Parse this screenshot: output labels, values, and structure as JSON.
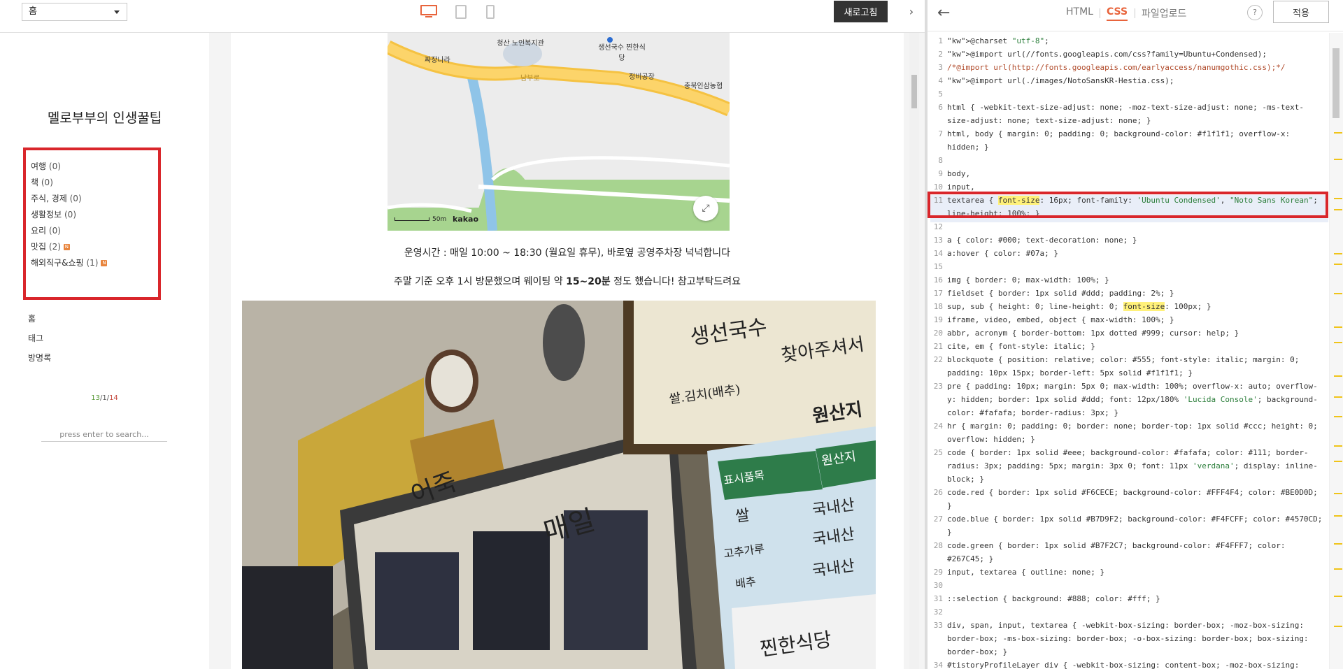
{
  "toolbar": {
    "page_select": "홈",
    "refresh_label": "새로고침",
    "collapse_icon": "›"
  },
  "sidebar": {
    "blog_title": "멜로부부의 인생꿀팁",
    "categories": [
      {
        "label": "여행",
        "count": "(0)",
        "badge": ""
      },
      {
        "label": "책",
        "count": "(0)",
        "badge": ""
      },
      {
        "label": "주식, 경제",
        "count": "(0)",
        "badge": ""
      },
      {
        "label": "생활정보",
        "count": "(0)",
        "badge": ""
      },
      {
        "label": "요리",
        "count": "(0)",
        "badge": ""
      },
      {
        "label": "맛집",
        "count": "(2)",
        "badge": "N"
      },
      {
        "label": "해외직구&쇼핑",
        "count": "(1)",
        "badge": "N"
      }
    ],
    "nav": [
      "홈",
      "태그",
      "방명록"
    ],
    "counter": {
      "today": "13",
      "sep1": "/",
      "yesterday": "1",
      "sep2": "/",
      "total": "14"
    },
    "search_placeholder": "press enter to search..."
  },
  "post": {
    "map": {
      "labels": [
        "짜장나라",
        "청산 노인복지관",
        "생선국수 찐한식당",
        "정비공장",
        "충북인삼농협",
        "남부로"
      ],
      "scale": "50m",
      "brand": "kakao"
    },
    "line1": "운영시간 : 매일 10:00 ~ 18:30 (월요일 휴무), 바로옆 공영주차장 넉넉합니다",
    "line2_prefix": "주말 기준 오후 1시 방문했으며 웨이팅 약 ",
    "line2_bold": "15~20분",
    "line2_suffix": " 정도 했습니다! 참고부탁드려요",
    "photo_texts": [
      "생선국수",
      "찾아주셔서",
      "쌀.김치(배추)",
      "원산지",
      "원산지",
      "표시품목",
      "쌀",
      "국내산",
      "고추가루",
      "국내산",
      "배추",
      "국내산",
      "찐한식당",
      "어죽",
      "매일"
    ]
  },
  "editor": {
    "back_icon": "←",
    "tabs": [
      "HTML",
      "CSS",
      "파일업로드"
    ],
    "help": "?",
    "apply": "적용",
    "code": [
      {
        "n": "1",
        "t": "@charset \"utf-8\";"
      },
      {
        "n": "2",
        "t": "@import url(//fonts.googleapis.com/css?family=Ubuntu+Condensed);"
      },
      {
        "n": "3",
        "t": "/*@import url(http://fonts.googleapis.com/earlyaccess/nanumgothic.css);*/"
      },
      {
        "n": "4",
        "t": "@import url(./images/NotoSansKR-Hestia.css);"
      },
      {
        "n": "5",
        "t": ""
      },
      {
        "n": "6",
        "t": "html { -webkit-text-size-adjust: none; -moz-text-size-adjust: none; -ms-text-"
      },
      {
        "n": "",
        "t": "size-adjust: none; text-size-adjust: none; }"
      },
      {
        "n": "7",
        "t": "html, body { margin: 0; padding: 0; background-color: #f1f1f1; overflow-x:"
      },
      {
        "n": "",
        "t": "hidden; }"
      },
      {
        "n": "8",
        "t": ""
      },
      {
        "n": "9",
        "t": "body,"
      },
      {
        "n": "10",
        "t": "input,"
      },
      {
        "n": "11",
        "t": "textarea { font-size: 16px; font-family: 'Ubuntu Condensed', \"Noto Sans Korean\";"
      },
      {
        "n": "",
        "t": "line-height: 100%; }"
      },
      {
        "n": "12",
        "t": ""
      },
      {
        "n": "13",
        "t": "a { color: #000; text-decoration: none; }"
      },
      {
        "n": "14",
        "t": "a:hover { color: #07a; }"
      },
      {
        "n": "15",
        "t": ""
      },
      {
        "n": "16",
        "t": "img { border: 0; max-width: 100%; }"
      },
      {
        "n": "17",
        "t": "fieldset { border: 1px solid #ddd; padding: 2%; }"
      },
      {
        "n": "18",
        "t": "sup, sub { height: 0; line-height: 0; font-size: 100px; }"
      },
      {
        "n": "19",
        "t": "iframe, video, embed, object { max-width: 100%; }"
      },
      {
        "n": "20",
        "t": "abbr, acronym { border-bottom: 1px dotted #999; cursor: help; }"
      },
      {
        "n": "21",
        "t": "cite, em { font-style: italic; }"
      },
      {
        "n": "22",
        "t": "blockquote { position: relative; color: #555; font-style: italic; margin: 0;"
      },
      {
        "n": "",
        "t": "padding: 10px 15px; border-left: 5px solid #f1f1f1; }"
      },
      {
        "n": "23",
        "t": "pre { padding: 10px; margin: 5px 0; max-width: 100%; overflow-x: auto; overflow-"
      },
      {
        "n": "",
        "t": "y: hidden; border: 1px solid #ddd; font: 12px/180% 'Lucida Console'; background-"
      },
      {
        "n": "",
        "t": "color: #fafafa; border-radius: 3px; }"
      },
      {
        "n": "24",
        "t": "hr { margin: 0; padding: 0; border: none; border-top: 1px solid #ccc; height: 0;"
      },
      {
        "n": "",
        "t": "overflow: hidden; }"
      },
      {
        "n": "25",
        "t": "code { border: 1px solid #eee; background-color: #fafafa; color: #111; border-"
      },
      {
        "n": "",
        "t": "radius: 3px; padding: 5px; margin: 3px 0; font: 11px 'verdana'; display: inline-"
      },
      {
        "n": "",
        "t": "block; }"
      },
      {
        "n": "26",
        "t": "code.red { border: 1px solid #F6CECE; background-color: #FFF4F4; color: #BE0D0D;"
      },
      {
        "n": "",
        "t": "}"
      },
      {
        "n": "27",
        "t": "code.blue { border: 1px solid #B7D9F2; background-color: #F4FCFF; color: #4570CD;"
      },
      {
        "n": "",
        "t": "}"
      },
      {
        "n": "28",
        "t": "code.green { border: 1px solid #B7F2C7; background-color: #F4FFF7; color:"
      },
      {
        "n": "",
        "t": "#267C45; }"
      },
      {
        "n": "29",
        "t": "input, textarea { outline: none; }"
      },
      {
        "n": "30",
        "t": ""
      },
      {
        "n": "31",
        "t": "::selection { background: #888; color: #fff; }"
      },
      {
        "n": "32",
        "t": ""
      },
      {
        "n": "33",
        "t": "div, span, input, textarea { -webkit-box-sizing: border-box; -moz-box-sizing:"
      },
      {
        "n": "",
        "t": "border-box; -ms-box-sizing: border-box; -o-box-sizing: border-box; box-sizing:"
      },
      {
        "n": "",
        "t": "border-box; }"
      },
      {
        "n": "34",
        "t": "#tistoryProfileLayer div { -webkit-box-sizing: content-box; -moz-box-sizing:"
      }
    ]
  },
  "colors": {
    "accent": "#e8643c",
    "highlight_box": "#d9262b",
    "search_hit": "#fff17a"
  }
}
